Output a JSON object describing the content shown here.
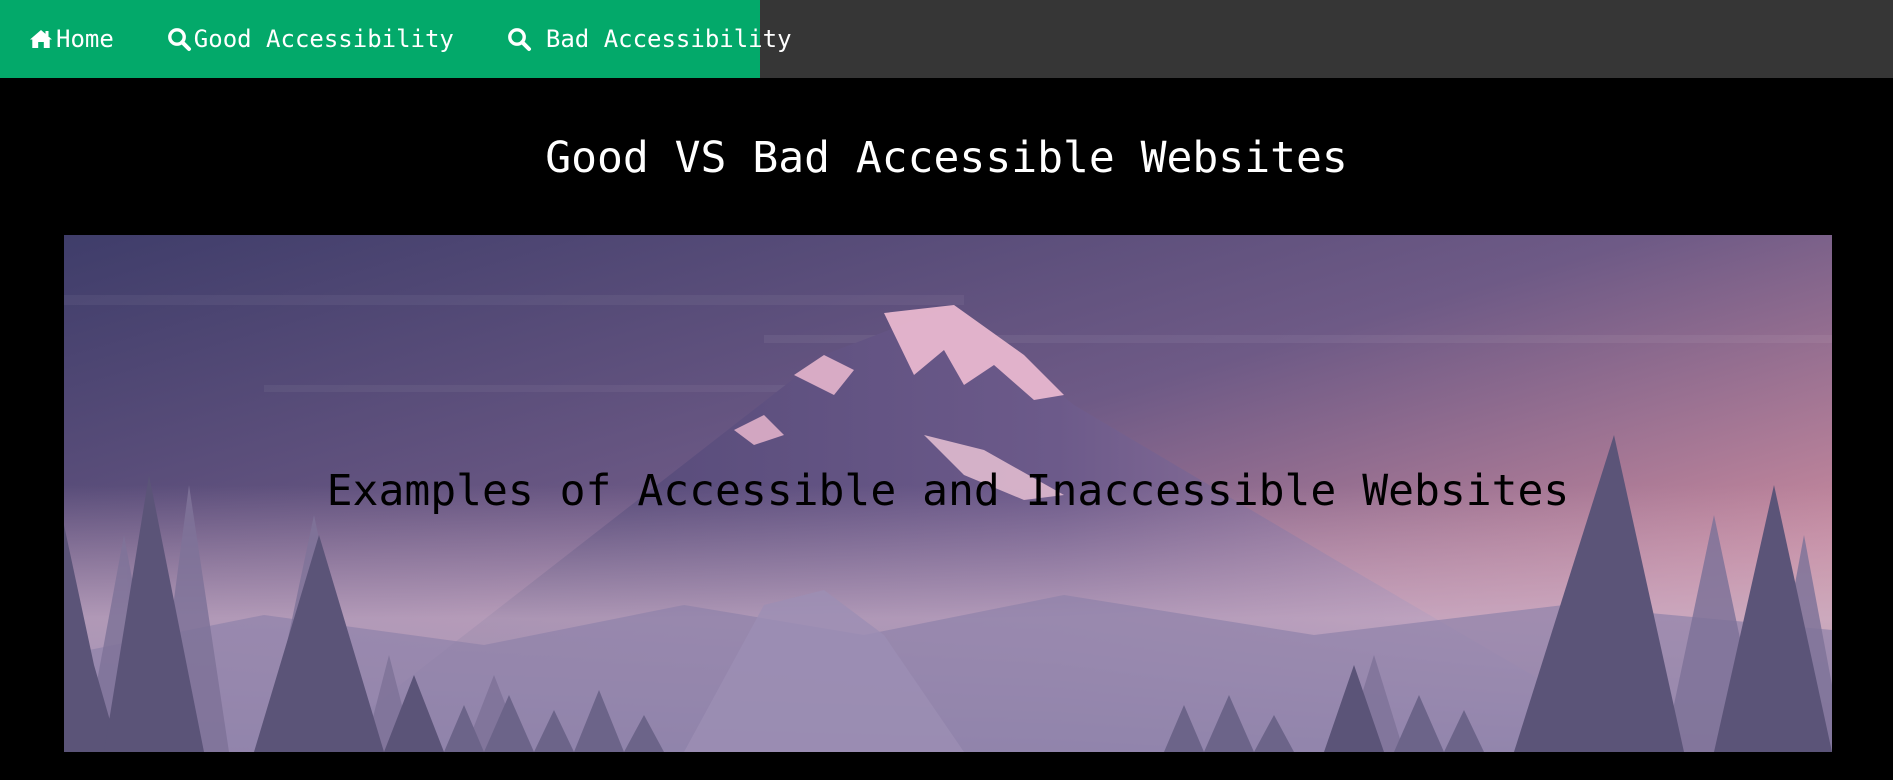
{
  "nav": {
    "items": [
      {
        "label": "Home",
        "icon": "home-icon"
      },
      {
        "label": "Good Accessibility",
        "icon": "search-icon"
      },
      {
        "label": "Bad Accessibility",
        "icon": "search-icon"
      }
    ]
  },
  "header": {
    "title": "Good VS Bad Accessible Websites"
  },
  "hero": {
    "caption": "Examples of Accessible and Inaccessible Websites",
    "image": "mountain-landscape-illustration"
  },
  "colors": {
    "nav_accent": "#03a96a",
    "topbar": "#363636",
    "page_background": "#000000",
    "nav_text": "#ffffff",
    "title_text": "#ffffff",
    "caption_text": "#000000"
  }
}
